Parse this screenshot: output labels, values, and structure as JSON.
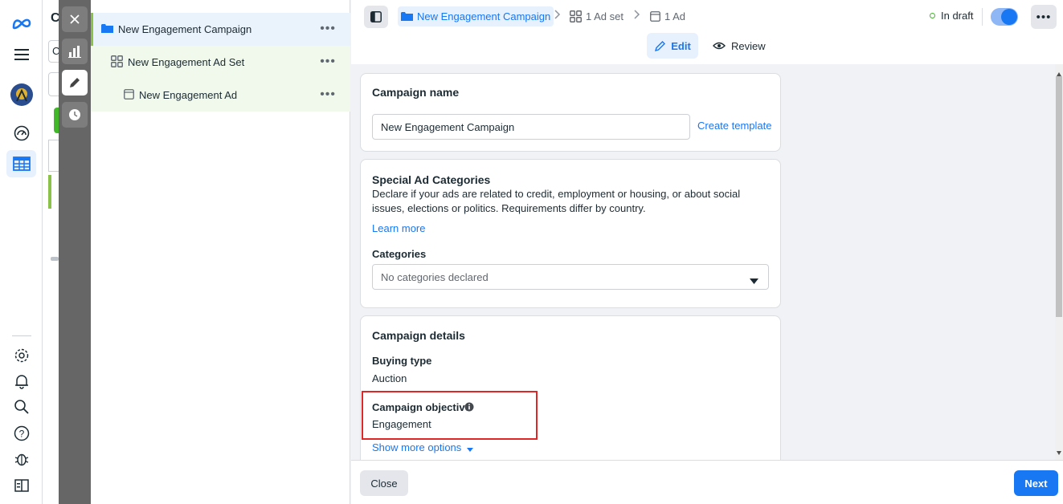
{
  "under_page": {
    "title_fragment": "C",
    "input_fragment": "C"
  },
  "tree": {
    "campaign": {
      "label": "New Engagement Campaign",
      "more": "•••"
    },
    "ad_set": {
      "label": "New Engagement Ad Set",
      "more": "•••"
    },
    "ad": {
      "label": "New Engagement Ad",
      "more": "•••"
    }
  },
  "topbar": {
    "breadcrumb": {
      "campaign": "New Engagement Campaign",
      "ad_set": "1 Ad set",
      "ad": "1 Ad"
    },
    "status": "In draft",
    "more": "•••",
    "tabs": {
      "edit": "Edit",
      "review": "Review"
    }
  },
  "campaign_name_card": {
    "title": "Campaign name",
    "input_value": "New Engagement Campaign",
    "create_template": "Create template"
  },
  "special_ad_card": {
    "title": "Special Ad Categories",
    "description": "Declare if your ads are related to credit, employment or housing, or about social issues, elections or politics. Requirements differ by country.",
    "learn_more": "Learn more",
    "categories_label": "Categories",
    "categories_placeholder": "No categories declared"
  },
  "campaign_details_card": {
    "title": "Campaign details",
    "buying_type_label": "Buying type",
    "buying_type_value": "Auction",
    "objective_label": "Campaign objective",
    "objective_value": "Engagement",
    "show_more": "Show more options"
  },
  "footer": {
    "close": "Close",
    "next": "Next"
  },
  "colors": {
    "accent": "#1877f2",
    "highlight": "#e02727",
    "draft_dot": "#42b72a"
  }
}
